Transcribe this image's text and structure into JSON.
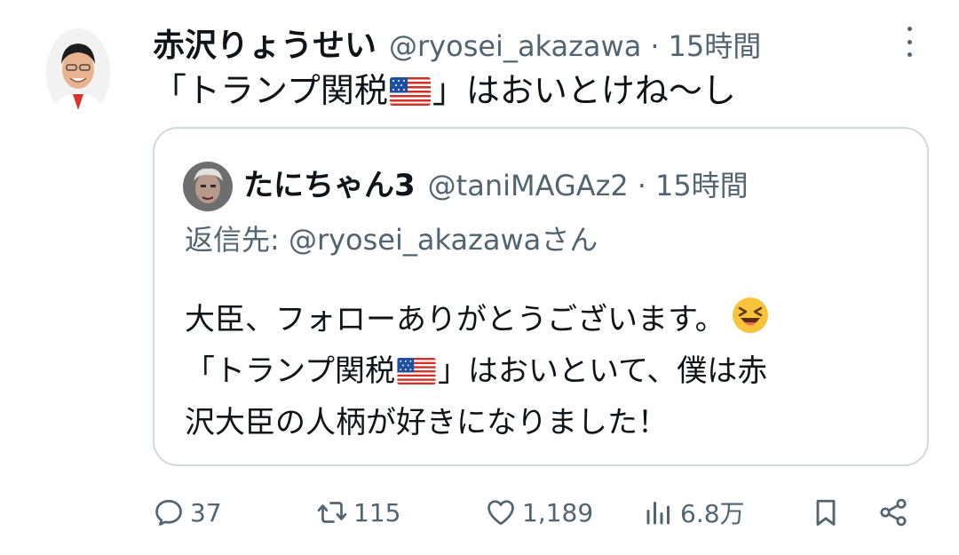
{
  "tweet": {
    "author_name": "赤沢りょうせい",
    "handle": "@ryosei_akazawa",
    "separator": "·",
    "time": "15時間",
    "text_before_flag": "「トランプ関税",
    "text_after_flag": "」はおいとけね〜し"
  },
  "quoted": {
    "author_name": "たにちゃん3",
    "handle": "@taniMAGAz2",
    "separator": "·",
    "time": "15時間",
    "reply_to": "返信先: @ryosei_akazawaさん",
    "line1": "大臣、フォローありがとうございます。",
    "line2_before_flag": "「トランプ関税",
    "line2_after_flag": "」はおいといて、僕は赤",
    "line3": "沢大臣の人柄が好きになりました！"
  },
  "actions": {
    "reply_count": "37",
    "retweet_count": "115",
    "like_count": "1,189",
    "view_count": "6.8万"
  },
  "icons": {
    "reply": "reply-icon",
    "retweet": "retweet-icon",
    "like": "heart-icon",
    "views": "views-icon",
    "bookmark": "bookmark-icon",
    "share": "share-icon",
    "more": "more-vertical-icon",
    "flag": "us-flag-emoji",
    "emoji": "grinning-squinting-face-emoji"
  },
  "colors": {
    "text": "#0f1419",
    "secondary": "#536471",
    "border": "#cfd9de"
  }
}
